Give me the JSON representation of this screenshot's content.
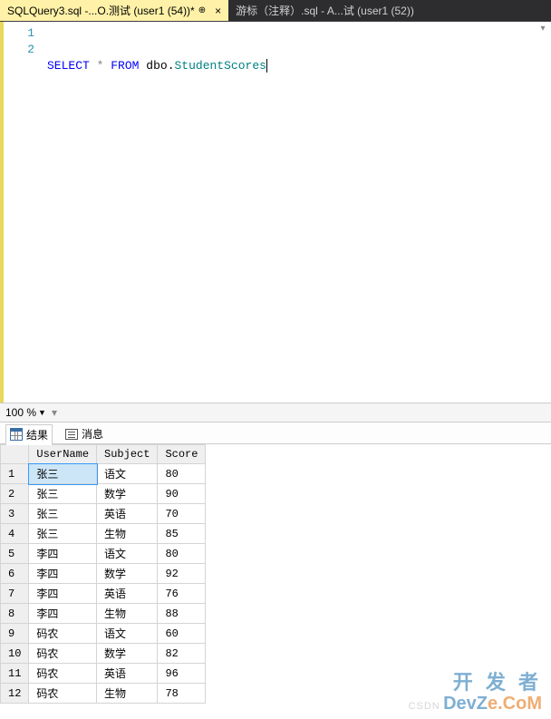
{
  "tabs": [
    {
      "label": "SQLQuery3.sql -...O.测试 (user1 (54))*",
      "active": true,
      "pinned": true
    },
    {
      "label": "游标（注释）.sql - A...试 (user1 (52))",
      "active": false,
      "pinned": false
    }
  ],
  "editor": {
    "lines": [
      "1",
      "2"
    ],
    "sql": {
      "select": "SELECT",
      "star": "*",
      "from": "FROM",
      "schema": "dbo",
      "dot": ".",
      "table": "StudentScores"
    }
  },
  "zoom": {
    "value": "100 %"
  },
  "result_tabs": {
    "results": "结果",
    "messages": "消息"
  },
  "grid": {
    "columns": [
      "UserName",
      "Subject",
      "Score"
    ],
    "rows": [
      {
        "n": "1",
        "UserName": "张三",
        "Subject": "语文",
        "Score": "80"
      },
      {
        "n": "2",
        "UserName": "张三",
        "Subject": "数学",
        "Score": "90"
      },
      {
        "n": "3",
        "UserName": "张三",
        "Subject": "英语",
        "Score": "70"
      },
      {
        "n": "4",
        "UserName": "张三",
        "Subject": "生物",
        "Score": "85"
      },
      {
        "n": "5",
        "UserName": "李四",
        "Subject": "语文",
        "Score": "80"
      },
      {
        "n": "6",
        "UserName": "李四",
        "Subject": "数学",
        "Score": "92"
      },
      {
        "n": "7",
        "UserName": "李四",
        "Subject": "英语",
        "Score": "76"
      },
      {
        "n": "8",
        "UserName": "李四",
        "Subject": "生物",
        "Score": "88"
      },
      {
        "n": "9",
        "UserName": "码农",
        "Subject": "语文",
        "Score": "60"
      },
      {
        "n": "10",
        "UserName": "码农",
        "Subject": "数学",
        "Score": "82"
      },
      {
        "n": "11",
        "UserName": "码农",
        "Subject": "英语",
        "Score": "96"
      },
      {
        "n": "12",
        "UserName": "码农",
        "Subject": "生物",
        "Score": "78"
      }
    ],
    "selected": {
      "row": 0,
      "col": "UserName"
    }
  },
  "watermark": {
    "cn": "开 发 者",
    "en1": "DevZ",
    "en2": "e.CoM",
    "csdn": "CSDN"
  }
}
